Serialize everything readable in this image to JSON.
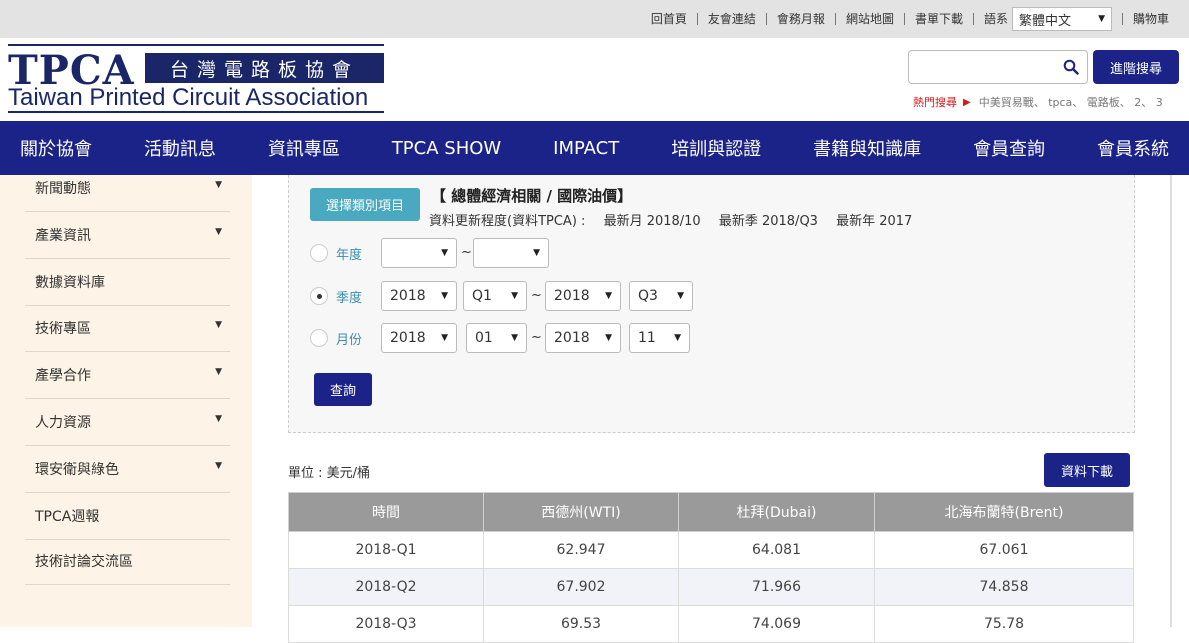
{
  "top_links": [
    "回首頁",
    "友會連結",
    "會務月報",
    "網站地圖",
    "書單下載"
  ],
  "language": {
    "label": "語系",
    "selected": "繁體中文"
  },
  "cart": "購物車",
  "logo": {
    "abbr": "TPCA",
    "chinese": "台灣電路板協會",
    "english": "Taiwan Printed Circuit Association"
  },
  "search": {
    "placeholder": "",
    "advanced_label": "進階搜尋",
    "icon": "search-icon"
  },
  "hot_search": {
    "label": "熱門搜尋",
    "terms": "中美貿易戰、 tpca、 電路板、 2、 3"
  },
  "nav": [
    "關於協會",
    "活動訊息",
    "資訊專區",
    "TPCA SHOW",
    "IMPACT",
    "培訓與認證",
    "書籍與知識庫",
    "會員查詢",
    "會員系統"
  ],
  "sidebar": [
    {
      "label": "新聞動態",
      "has_arrow": true
    },
    {
      "label": "產業資訊",
      "has_arrow": true
    },
    {
      "label": "數據資料庫",
      "has_arrow": false
    },
    {
      "label": "技術專區",
      "has_arrow": true
    },
    {
      "label": "產學合作",
      "has_arrow": true
    },
    {
      "label": "人力資源",
      "has_arrow": true
    },
    {
      "label": "環安衛與綠色",
      "has_arrow": true
    },
    {
      "label": "TPCA週報",
      "has_arrow": false
    },
    {
      "label": "技術討論交流區",
      "has_arrow": false
    }
  ],
  "filter": {
    "category_button": "選擇類別項目",
    "category_title": "【 總體經濟相關 / 國際油價】",
    "update_label": "資料更新程度(資料TPCA) :",
    "latest_month": "最新月 2018/10",
    "latest_quarter": "最新季 2018/Q3",
    "latest_year": "最新年 2017",
    "rows": [
      {
        "label": "年度",
        "selected": false,
        "from": [
          "",
          ""
        ],
        "to": [
          "",
          ""
        ]
      },
      {
        "label": "季度",
        "selected": true,
        "from": [
          "2018",
          "Q1"
        ],
        "to": [
          "2018",
          "Q3"
        ]
      },
      {
        "label": "月份",
        "selected": false,
        "from": [
          "2018",
          "01"
        ],
        "to": [
          "2018",
          "11"
        ]
      }
    ],
    "tilde": "~",
    "query_label": "查詢"
  },
  "unit": "單位 : 美元/桶",
  "download_label": "資料下載",
  "table": {
    "headers": [
      "時間",
      "西德州(WTI)",
      "杜拜(Dubai)",
      "北海布蘭特(Brent)"
    ],
    "rows": [
      [
        "2018-Q1",
        "62.947",
        "64.081",
        "67.061"
      ],
      [
        "2018-Q2",
        "67.902",
        "71.966",
        "74.858"
      ],
      [
        "2018-Q3",
        "69.53",
        "74.069",
        "75.78"
      ]
    ]
  }
}
